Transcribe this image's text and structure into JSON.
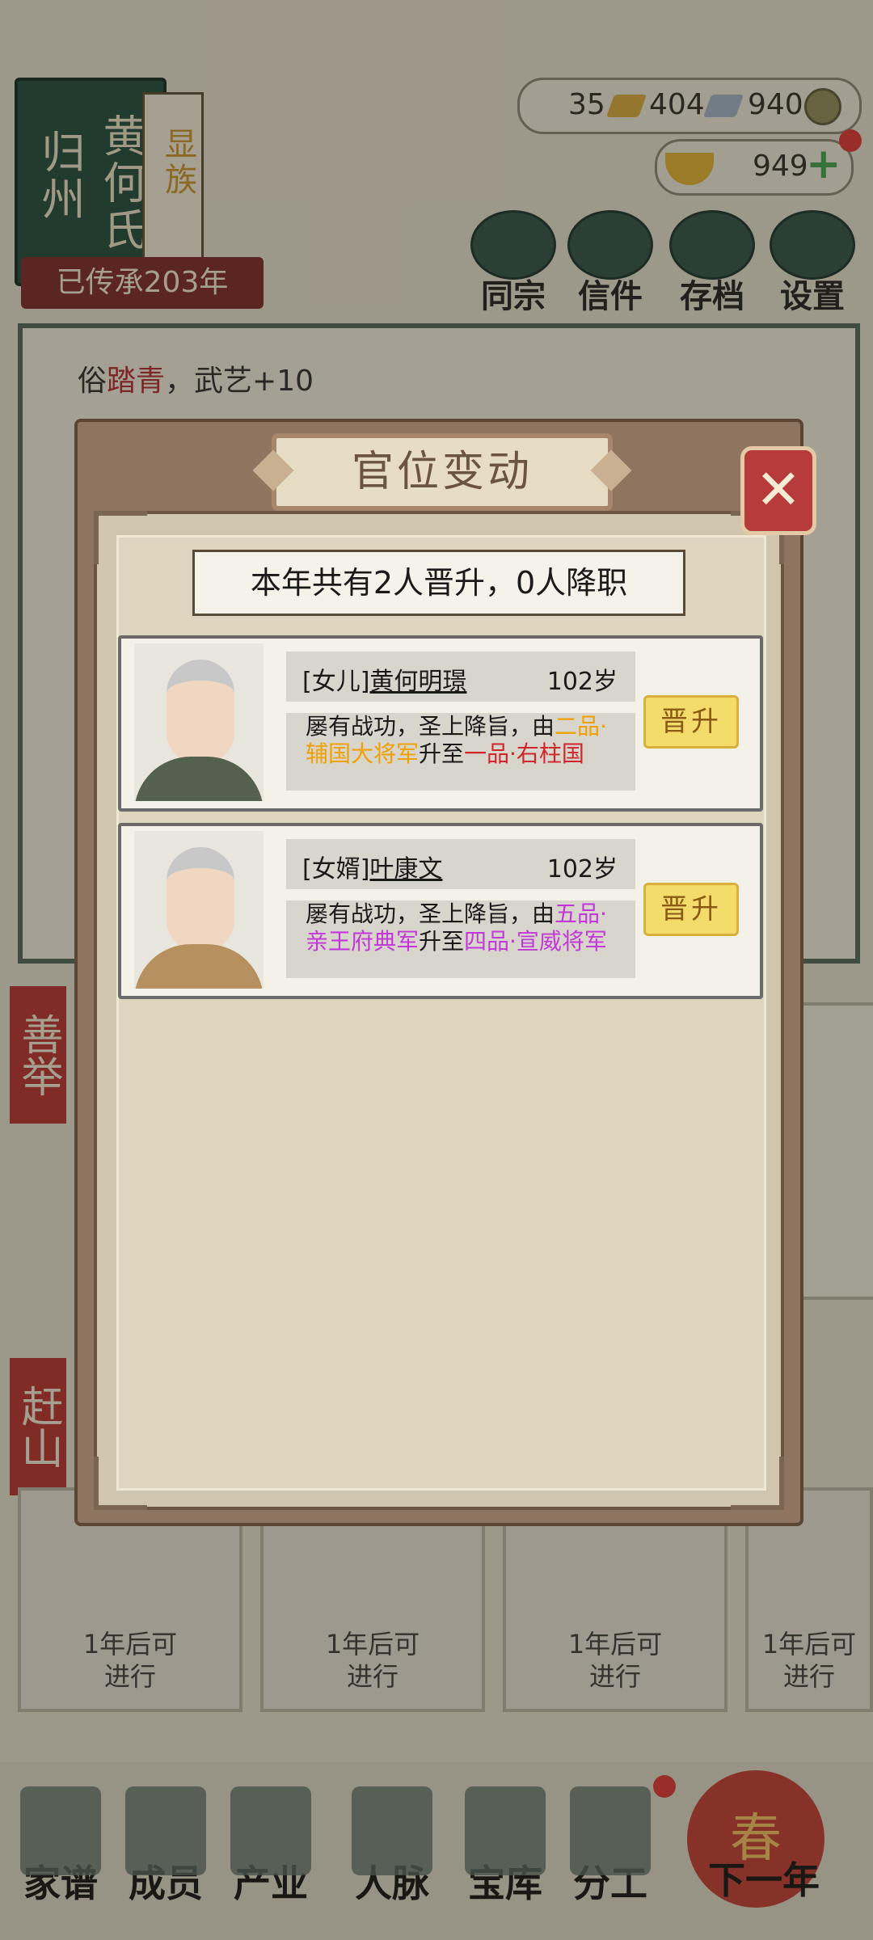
{
  "clan": {
    "place": "归州",
    "family": "黄何氏",
    "rank": "显族",
    "heritage": "已传承203年"
  },
  "resources": {
    "gold_bars": "35",
    "silver_bars": "404",
    "coins": "940",
    "ingots": "949"
  },
  "top_menu": [
    "同宗",
    "信件",
    "存档",
    "设置"
  ],
  "background": {
    "line1_prefix": "俗",
    "line1_red": "踏青",
    "line1_suffix": "，武艺+10"
  },
  "side_tabs": [
    "善举",
    "赶山"
  ],
  "cards": [
    "1年后可\n进行",
    "1年后可\n进行",
    "1年后可\n进行",
    "1年后可\n进行"
  ],
  "bottom_nav": [
    "家谱",
    "成员",
    "产业",
    "人脉",
    "宝库",
    "分工",
    "下一年"
  ],
  "lantern": "春",
  "modal": {
    "title": "官位变动",
    "close_icon": "close-x",
    "summary": "本年共有2人晋升，0人降职",
    "entries": [
      {
        "relation": "[女儿]",
        "name": "黄何明璟",
        "age": "102岁",
        "desc_a": "屡有战功，圣上降旨，由",
        "from": "二品·辅国大将军",
        "desc_b": "升至",
        "to": "一品·右柱国",
        "badge": "晋升"
      },
      {
        "relation": "[女婿]",
        "name": "叶康文",
        "age": "102岁",
        "desc_a": "屡有战功，圣上降旨，由",
        "from": "五品·亲王府典军",
        "desc_b": "升至",
        "to": "四品·宣威将军",
        "badge": "晋升"
      }
    ]
  },
  "colors": {
    "orange_rank": "#f0a000",
    "red_rank": "#d0252b",
    "magenta_rank": "#c238d8",
    "close_button": "#b83b3b",
    "promo_badge": "#f4dc6c"
  }
}
